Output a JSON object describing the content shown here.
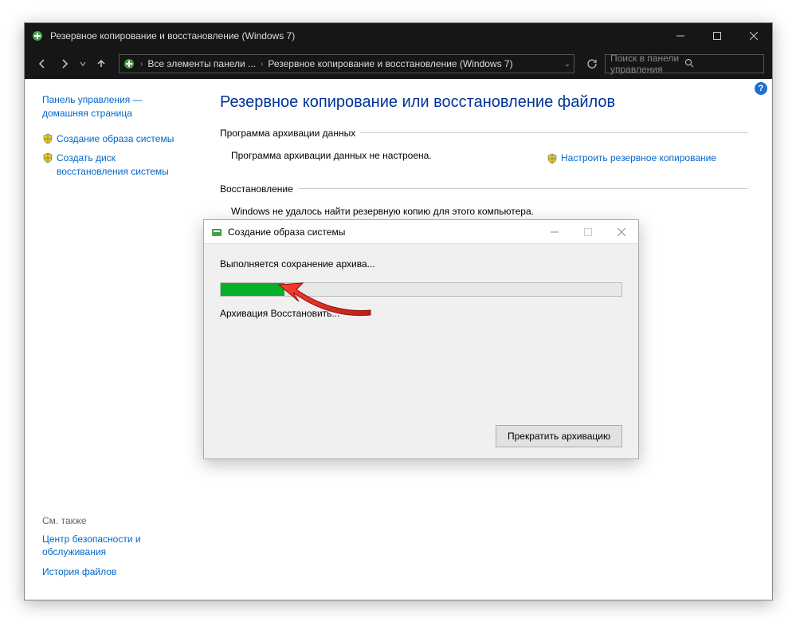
{
  "window": {
    "title": "Резервное копирование и восстановление (Windows 7)"
  },
  "addressbar": {
    "part1": "Все элементы панели ...",
    "part2": "Резервное копирование и восстановление (Windows 7)"
  },
  "search": {
    "placeholder": "Поиск в панели управления"
  },
  "sidebar": {
    "home": "Панель управления — домашняя страница",
    "createImage": "Создание образа системы",
    "createDisk": "Создать диск восстановления системы",
    "seeAlsoLabel": "См. также",
    "security": "Центр безопасности и обслуживания",
    "history": "История файлов"
  },
  "main": {
    "title": "Резервное копирование или восстановление файлов",
    "archGroup": "Программа архивации данных",
    "archText": "Программа архивации данных не настроена.",
    "configLink": "Настроить резервное копирование",
    "restoreGroup": "Восстановление",
    "restoreText": "Windows не удалось найти резервную копию для этого компьютера."
  },
  "dialog": {
    "title": "Создание образа системы",
    "heading": "Выполняется сохранение архива...",
    "progressText": "Архивация Восстановить...",
    "stopButton": "Прекратить архивацию"
  }
}
